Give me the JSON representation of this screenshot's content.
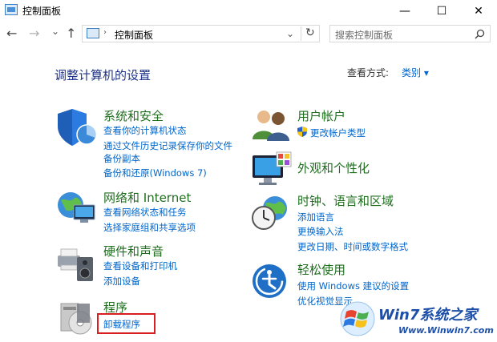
{
  "window": {
    "title": "控制面板",
    "minimize_glyph": "—",
    "maximize_glyph": "☐",
    "close_glyph": "✕"
  },
  "nav": {
    "back_glyph": "←",
    "forward_glyph": "→",
    "recent_glyph": "⌄",
    "up_glyph": "↑",
    "address_path": "控制面板",
    "address_dropdown_glyph": "⌄",
    "refresh_glyph": "↻",
    "search_placeholder": "搜索控制面板",
    "search_icon": "search-icon"
  },
  "header": {
    "title": "调整计算机的设置",
    "view_by_label": "查看方式:",
    "view_by_value": "类别 ▾"
  },
  "categories_left": [
    {
      "title": "系统和安全",
      "icon": "shield-icon",
      "links": [
        "查看你的计算机状态",
        "通过文件历史记录保存你的文件",
        "备份副本",
        "备份和还原(Windows 7)"
      ]
    },
    {
      "title": "网络和 Internet",
      "icon": "network-globe-icon",
      "links": [
        "查看网络状态和任务",
        "选择家庭组和共享选项"
      ]
    },
    {
      "title": "硬件和声音",
      "icon": "printer-speaker-icon",
      "links": [
        "查看设备和打印机",
        "添加设备"
      ]
    },
    {
      "title": "程序",
      "icon": "programs-disc-icon",
      "links": [
        "卸载程序"
      ]
    }
  ],
  "categories_right": [
    {
      "title": "用户帐户",
      "icon": "users-icon",
      "links": [
        "更改帐户类型"
      ]
    },
    {
      "title": "外观和个性化",
      "icon": "monitor-palette-icon",
      "links": []
    },
    {
      "title": "时钟、语言和区域",
      "icon": "clock-globe-icon",
      "links": [
        "添加语言",
        "更换输入法",
        "更改日期、时间或数字格式"
      ]
    },
    {
      "title": "轻松使用",
      "icon": "ease-of-access-icon",
      "links": [
        "使用 Windows 建议的设置",
        "优化视觉显示"
      ]
    }
  ],
  "watermark": {
    "brand": "Win7系统之家",
    "url": "Www.Winwin7.com"
  },
  "colors": {
    "link": "#0066cc",
    "category_title": "#1e6e1e",
    "page_title": "#1e3287",
    "highlight_box": "#d81e1e"
  }
}
